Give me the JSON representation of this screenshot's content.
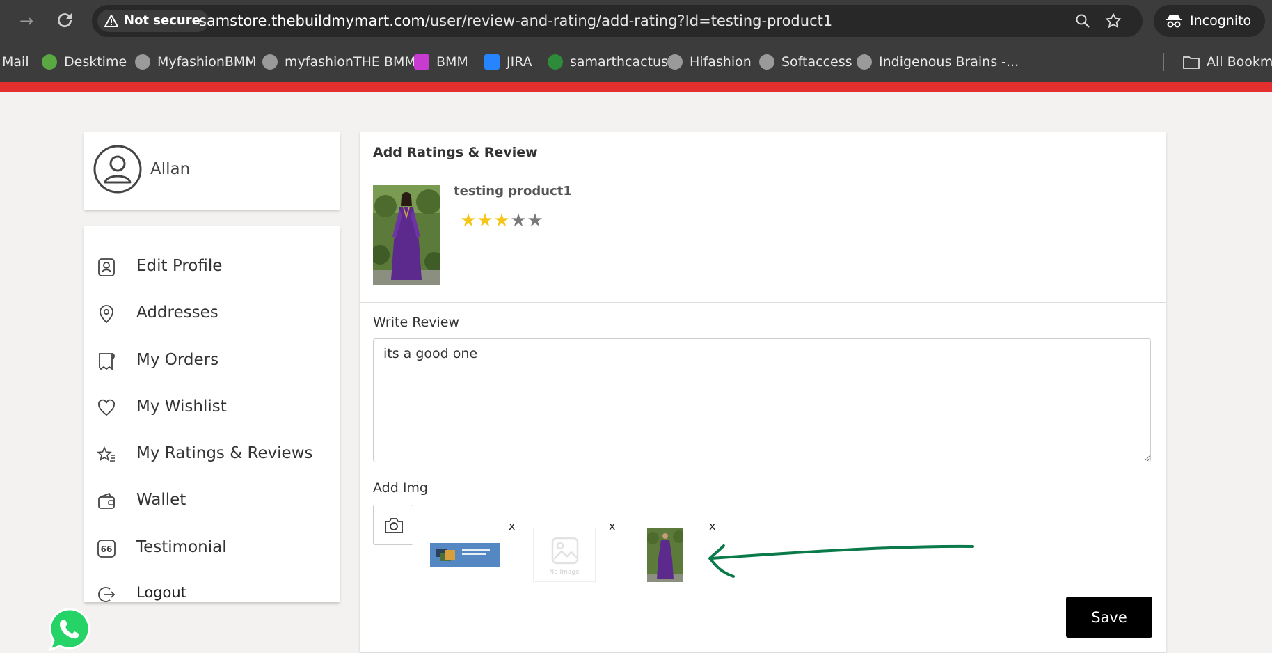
{
  "browser": {
    "security_label": "Not secure",
    "url_host": "samstore.thebuildmymart.com",
    "url_path": "/user/review-and-rating/add-rating?Id=testing-product1",
    "incognito_label": "Incognito"
  },
  "bookmarks": [
    {
      "label": "Mail",
      "icon": "mail-icon"
    },
    {
      "label": "Desktime",
      "icon": "desktime-icon",
      "color": "#5aa842"
    },
    {
      "label": "MyfashionBMM",
      "icon": "globe-icon"
    },
    {
      "label": "myfashionTHE BMM",
      "icon": "globe-icon"
    },
    {
      "label": "BMM",
      "icon": "bmm-icon",
      "color": "#c83bd1"
    },
    {
      "label": "JIRA",
      "icon": "jira-icon",
      "color": "#2684ff"
    },
    {
      "label": "samarthcactus",
      "icon": "cactus-icon",
      "color": "#2e8b3a"
    },
    {
      "label": "Hifashion",
      "icon": "globe-icon"
    },
    {
      "label": "Softaccess",
      "icon": "globe-icon"
    },
    {
      "label": "Indigenous Brains -...",
      "icon": "globe-icon"
    },
    {
      "label": "All Bookmar",
      "icon": "folder-icon"
    }
  ],
  "profile": {
    "name": "Allan"
  },
  "menu": [
    {
      "label": "Edit Profile",
      "icon": "user-card-icon"
    },
    {
      "label": "Addresses",
      "icon": "location-pin-icon"
    },
    {
      "label": "My Orders",
      "icon": "receipt-icon"
    },
    {
      "label": "My Wishlist",
      "icon": "heart-icon"
    },
    {
      "label": "My Ratings & Reviews",
      "icon": "star-rating-icon"
    },
    {
      "label": "Wallet",
      "icon": "wallet-icon"
    },
    {
      "label": "Testimonial",
      "icon": "quote-icon"
    },
    {
      "label": "Logout",
      "icon": "logout-icon"
    }
  ],
  "rating_section": {
    "title": "Add Ratings & Review",
    "product_name": "testing product1",
    "rating": 3,
    "max_rating": 5
  },
  "review_section": {
    "title": "Write Review",
    "text": "its a good one"
  },
  "image_section": {
    "title": "Add Img",
    "remove_label": "x",
    "no_image_label": "No Image"
  },
  "actions": {
    "save_label": "Save"
  },
  "colors": {
    "accent_red": "#e3302e",
    "star_filled": "#f5c518",
    "star_empty": "#7a7a7a",
    "annotation_arrow": "#0b7a4b",
    "whatsapp_green": "#25d366"
  }
}
